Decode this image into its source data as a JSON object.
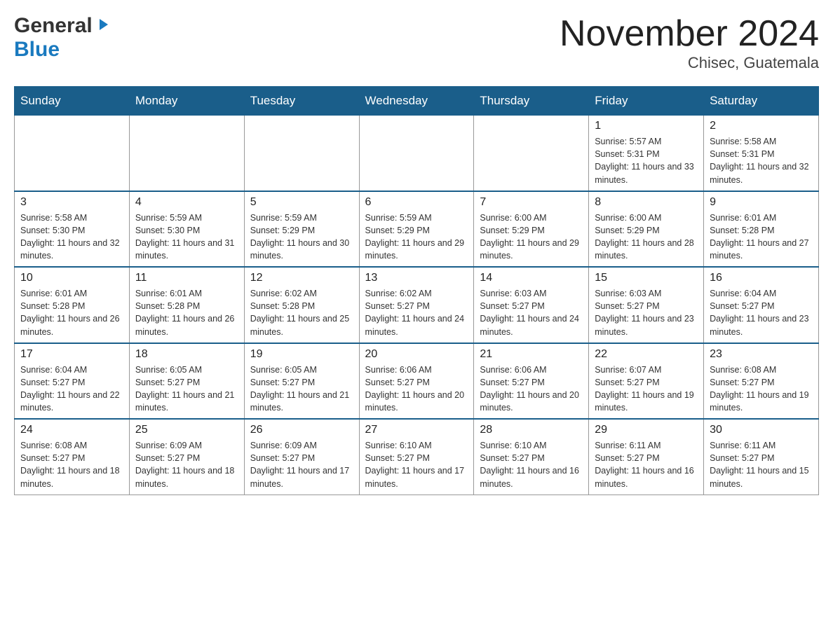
{
  "logo": {
    "general": "General",
    "blue": "Blue"
  },
  "title": "November 2024",
  "subtitle": "Chisec, Guatemala",
  "weekdays": [
    "Sunday",
    "Monday",
    "Tuesday",
    "Wednesday",
    "Thursday",
    "Friday",
    "Saturday"
  ],
  "weeks": [
    {
      "days": [
        {
          "num": "",
          "info": ""
        },
        {
          "num": "",
          "info": ""
        },
        {
          "num": "",
          "info": ""
        },
        {
          "num": "",
          "info": ""
        },
        {
          "num": "",
          "info": ""
        },
        {
          "num": "1",
          "info": "Sunrise: 5:57 AM\nSunset: 5:31 PM\nDaylight: 11 hours and 33 minutes."
        },
        {
          "num": "2",
          "info": "Sunrise: 5:58 AM\nSunset: 5:31 PM\nDaylight: 11 hours and 32 minutes."
        }
      ]
    },
    {
      "days": [
        {
          "num": "3",
          "info": "Sunrise: 5:58 AM\nSunset: 5:30 PM\nDaylight: 11 hours and 32 minutes."
        },
        {
          "num": "4",
          "info": "Sunrise: 5:59 AM\nSunset: 5:30 PM\nDaylight: 11 hours and 31 minutes."
        },
        {
          "num": "5",
          "info": "Sunrise: 5:59 AM\nSunset: 5:29 PM\nDaylight: 11 hours and 30 minutes."
        },
        {
          "num": "6",
          "info": "Sunrise: 5:59 AM\nSunset: 5:29 PM\nDaylight: 11 hours and 29 minutes."
        },
        {
          "num": "7",
          "info": "Sunrise: 6:00 AM\nSunset: 5:29 PM\nDaylight: 11 hours and 29 minutes."
        },
        {
          "num": "8",
          "info": "Sunrise: 6:00 AM\nSunset: 5:29 PM\nDaylight: 11 hours and 28 minutes."
        },
        {
          "num": "9",
          "info": "Sunrise: 6:01 AM\nSunset: 5:28 PM\nDaylight: 11 hours and 27 minutes."
        }
      ]
    },
    {
      "days": [
        {
          "num": "10",
          "info": "Sunrise: 6:01 AM\nSunset: 5:28 PM\nDaylight: 11 hours and 26 minutes."
        },
        {
          "num": "11",
          "info": "Sunrise: 6:01 AM\nSunset: 5:28 PM\nDaylight: 11 hours and 26 minutes."
        },
        {
          "num": "12",
          "info": "Sunrise: 6:02 AM\nSunset: 5:28 PM\nDaylight: 11 hours and 25 minutes."
        },
        {
          "num": "13",
          "info": "Sunrise: 6:02 AM\nSunset: 5:27 PM\nDaylight: 11 hours and 24 minutes."
        },
        {
          "num": "14",
          "info": "Sunrise: 6:03 AM\nSunset: 5:27 PM\nDaylight: 11 hours and 24 minutes."
        },
        {
          "num": "15",
          "info": "Sunrise: 6:03 AM\nSunset: 5:27 PM\nDaylight: 11 hours and 23 minutes."
        },
        {
          "num": "16",
          "info": "Sunrise: 6:04 AM\nSunset: 5:27 PM\nDaylight: 11 hours and 23 minutes."
        }
      ]
    },
    {
      "days": [
        {
          "num": "17",
          "info": "Sunrise: 6:04 AM\nSunset: 5:27 PM\nDaylight: 11 hours and 22 minutes."
        },
        {
          "num": "18",
          "info": "Sunrise: 6:05 AM\nSunset: 5:27 PM\nDaylight: 11 hours and 21 minutes."
        },
        {
          "num": "19",
          "info": "Sunrise: 6:05 AM\nSunset: 5:27 PM\nDaylight: 11 hours and 21 minutes."
        },
        {
          "num": "20",
          "info": "Sunrise: 6:06 AM\nSunset: 5:27 PM\nDaylight: 11 hours and 20 minutes."
        },
        {
          "num": "21",
          "info": "Sunrise: 6:06 AM\nSunset: 5:27 PM\nDaylight: 11 hours and 20 minutes."
        },
        {
          "num": "22",
          "info": "Sunrise: 6:07 AM\nSunset: 5:27 PM\nDaylight: 11 hours and 19 minutes."
        },
        {
          "num": "23",
          "info": "Sunrise: 6:08 AM\nSunset: 5:27 PM\nDaylight: 11 hours and 19 minutes."
        }
      ]
    },
    {
      "days": [
        {
          "num": "24",
          "info": "Sunrise: 6:08 AM\nSunset: 5:27 PM\nDaylight: 11 hours and 18 minutes."
        },
        {
          "num": "25",
          "info": "Sunrise: 6:09 AM\nSunset: 5:27 PM\nDaylight: 11 hours and 18 minutes."
        },
        {
          "num": "26",
          "info": "Sunrise: 6:09 AM\nSunset: 5:27 PM\nDaylight: 11 hours and 17 minutes."
        },
        {
          "num": "27",
          "info": "Sunrise: 6:10 AM\nSunset: 5:27 PM\nDaylight: 11 hours and 17 minutes."
        },
        {
          "num": "28",
          "info": "Sunrise: 6:10 AM\nSunset: 5:27 PM\nDaylight: 11 hours and 16 minutes."
        },
        {
          "num": "29",
          "info": "Sunrise: 6:11 AM\nSunset: 5:27 PM\nDaylight: 11 hours and 16 minutes."
        },
        {
          "num": "30",
          "info": "Sunrise: 6:11 AM\nSunset: 5:27 PM\nDaylight: 11 hours and 15 minutes."
        }
      ]
    }
  ]
}
